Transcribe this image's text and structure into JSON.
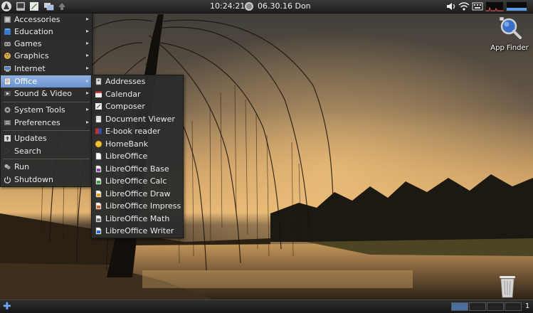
{
  "top_panel": {
    "clock": "10:24:21",
    "date": "06.30.16 Don",
    "launchers": [
      "app-menu-icon",
      "terminal-icon",
      "text-editor-icon",
      "window-switcher-icon",
      "up-arrow-icon"
    ],
    "tray": [
      "volume-icon",
      "wifi-icon",
      "keyboard-icon",
      "cpu-graph-icon",
      "network-graph-icon"
    ]
  },
  "main_menu": {
    "items": [
      {
        "label": "Accessories",
        "icon": "accessories-icon",
        "submenu": true
      },
      {
        "label": "Education",
        "icon": "education-icon",
        "submenu": true
      },
      {
        "label": "Games",
        "icon": "games-icon",
        "submenu": true
      },
      {
        "label": "Graphics",
        "icon": "graphics-icon",
        "submenu": true
      },
      {
        "label": "Internet",
        "icon": "internet-icon",
        "submenu": true
      },
      {
        "label": "Office",
        "icon": "office-icon",
        "submenu": true,
        "active": true
      },
      {
        "label": "Sound & Video",
        "icon": "sound-video-icon",
        "submenu": true
      },
      {
        "label": "System Tools",
        "icon": "system-tools-icon",
        "submenu": true
      },
      {
        "label": "Preferences",
        "icon": "preferences-icon",
        "submenu": true
      },
      {
        "label": "Updates",
        "icon": "updates-icon",
        "submenu": false
      },
      {
        "label": "Search",
        "icon": "search-icon",
        "submenu": false
      },
      {
        "label": "Run",
        "icon": "run-icon",
        "submenu": false
      },
      {
        "label": "Shutdown",
        "icon": "shutdown-icon",
        "submenu": false
      }
    ]
  },
  "office_submenu": {
    "items": [
      {
        "label": "Addresses",
        "icon": "addresses-icon"
      },
      {
        "label": "Calendar",
        "icon": "calendar-icon"
      },
      {
        "label": "Composer",
        "icon": "composer-icon"
      },
      {
        "label": "Document Viewer",
        "icon": "document-viewer-icon"
      },
      {
        "label": "E-book reader",
        "icon": "ebook-reader-icon"
      },
      {
        "label": "HomeBank",
        "icon": "homebank-icon"
      },
      {
        "label": "LibreOffice",
        "icon": "libreoffice-icon"
      },
      {
        "label": "LibreOffice Base",
        "icon": "libreoffice-base-icon"
      },
      {
        "label": "LibreOffice Calc",
        "icon": "libreoffice-calc-icon"
      },
      {
        "label": "LibreOffice Draw",
        "icon": "libreoffice-draw-icon"
      },
      {
        "label": "LibreOffice Impress",
        "icon": "libreoffice-impress-icon"
      },
      {
        "label": "LibreOffice Math",
        "icon": "libreoffice-math-icon"
      },
      {
        "label": "LibreOffice Writer",
        "icon": "libreoffice-writer-icon"
      }
    ]
  },
  "desktop": {
    "app_finder_label": "App Finder"
  },
  "bottom_panel": {
    "workspace_number": "1"
  },
  "colors": {
    "menu_bg": "#2c2c2c",
    "highlight": "#7aa2d8",
    "panel_bg": "#1e1e1e"
  }
}
